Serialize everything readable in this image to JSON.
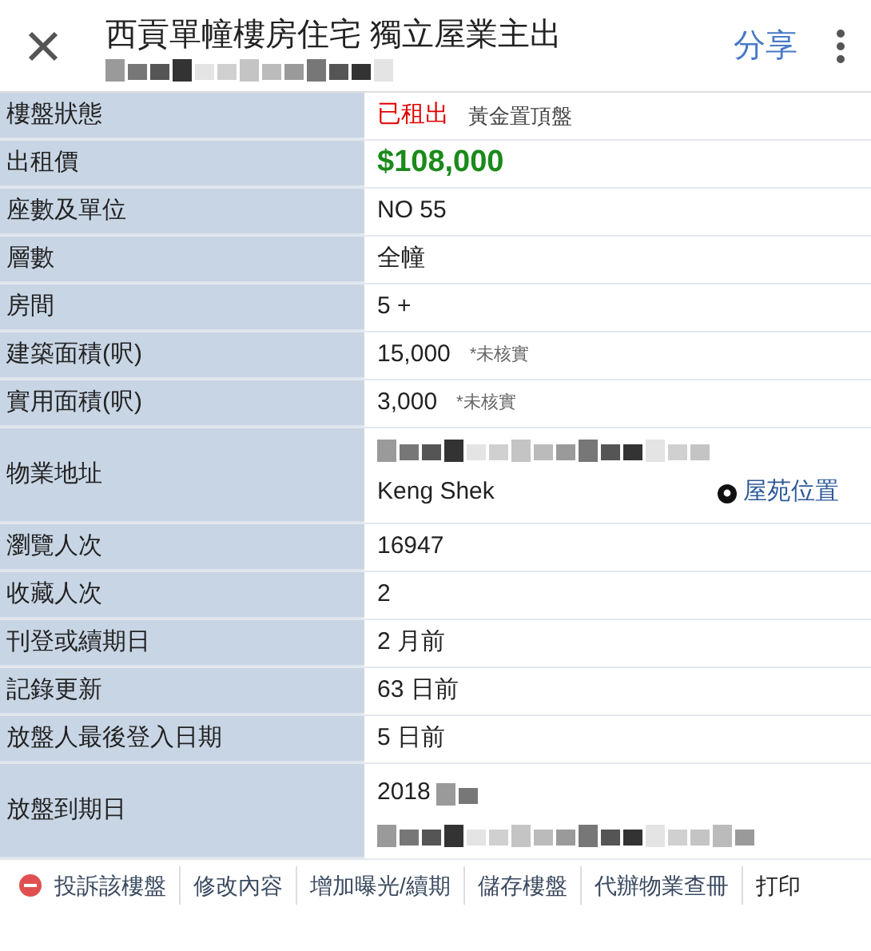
{
  "header": {
    "title": "西貢單幢樓房住宅 獨立屋業主出",
    "share": "分享"
  },
  "rows": [
    {
      "label": "樓盤狀態",
      "kind": "status",
      "value": "已租出",
      "note": "黃金置頂盤"
    },
    {
      "label": "出租價",
      "kind": "price",
      "value": "$108,000"
    },
    {
      "label": "座數及單位",
      "kind": "text",
      "value": "NO 55"
    },
    {
      "label": "層數",
      "kind": "text",
      "value": "全幢"
    },
    {
      "label": "房間",
      "kind": "text",
      "value": "5 +"
    },
    {
      "label": "建築面積(呎)",
      "kind": "area",
      "value": "15,000",
      "note": "*未核實"
    },
    {
      "label": "實用面積(呎)",
      "kind": "area",
      "value": "3,000",
      "note": "*未核實"
    },
    {
      "label": "物業地址",
      "kind": "address",
      "value": "Keng Shek",
      "link": "屋苑位置"
    },
    {
      "label": "瀏覽人次",
      "kind": "text",
      "value": "16947"
    },
    {
      "label": "收藏人次",
      "kind": "text",
      "value": "2"
    },
    {
      "label": "刊登或續期日",
      "kind": "text",
      "value": "2 月前"
    },
    {
      "label": "記錄更新",
      "kind": "text",
      "value": "63 日前"
    },
    {
      "label": "放盤人最後登入日期",
      "kind": "text",
      "value": "5 日前"
    },
    {
      "label": "放盤到期日",
      "kind": "expiry",
      "value": "2018"
    }
  ],
  "actions": [
    "投訴該樓盤",
    "修改內容",
    "增加曝光/續期",
    "儲存樓盤",
    "代辦物業查冊",
    "打印"
  ]
}
